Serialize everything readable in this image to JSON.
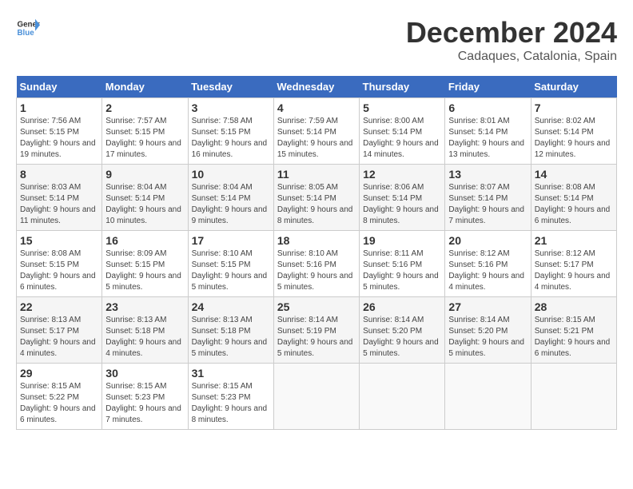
{
  "header": {
    "logo_general": "General",
    "logo_blue": "Blue",
    "month_title": "December 2024",
    "location": "Cadaques, Catalonia, Spain"
  },
  "calendar": {
    "days_of_week": [
      "Sunday",
      "Monday",
      "Tuesday",
      "Wednesday",
      "Thursday",
      "Friday",
      "Saturday"
    ],
    "weeks": [
      [
        {
          "day": "1",
          "sunrise": "Sunrise: 7:56 AM",
          "sunset": "Sunset: 5:15 PM",
          "daylight": "Daylight: 9 hours and 19 minutes."
        },
        {
          "day": "2",
          "sunrise": "Sunrise: 7:57 AM",
          "sunset": "Sunset: 5:15 PM",
          "daylight": "Daylight: 9 hours and 17 minutes."
        },
        {
          "day": "3",
          "sunrise": "Sunrise: 7:58 AM",
          "sunset": "Sunset: 5:15 PM",
          "daylight": "Daylight: 9 hours and 16 minutes."
        },
        {
          "day": "4",
          "sunrise": "Sunrise: 7:59 AM",
          "sunset": "Sunset: 5:14 PM",
          "daylight": "Daylight: 9 hours and 15 minutes."
        },
        {
          "day": "5",
          "sunrise": "Sunrise: 8:00 AM",
          "sunset": "Sunset: 5:14 PM",
          "daylight": "Daylight: 9 hours and 14 minutes."
        },
        {
          "day": "6",
          "sunrise": "Sunrise: 8:01 AM",
          "sunset": "Sunset: 5:14 PM",
          "daylight": "Daylight: 9 hours and 13 minutes."
        },
        {
          "day": "7",
          "sunrise": "Sunrise: 8:02 AM",
          "sunset": "Sunset: 5:14 PM",
          "daylight": "Daylight: 9 hours and 12 minutes."
        }
      ],
      [
        {
          "day": "8",
          "sunrise": "Sunrise: 8:03 AM",
          "sunset": "Sunset: 5:14 PM",
          "daylight": "Daylight: 9 hours and 11 minutes."
        },
        {
          "day": "9",
          "sunrise": "Sunrise: 8:04 AM",
          "sunset": "Sunset: 5:14 PM",
          "daylight": "Daylight: 9 hours and 10 minutes."
        },
        {
          "day": "10",
          "sunrise": "Sunrise: 8:04 AM",
          "sunset": "Sunset: 5:14 PM",
          "daylight": "Daylight: 9 hours and 9 minutes."
        },
        {
          "day": "11",
          "sunrise": "Sunrise: 8:05 AM",
          "sunset": "Sunset: 5:14 PM",
          "daylight": "Daylight: 9 hours and 8 minutes."
        },
        {
          "day": "12",
          "sunrise": "Sunrise: 8:06 AM",
          "sunset": "Sunset: 5:14 PM",
          "daylight": "Daylight: 9 hours and 8 minutes."
        },
        {
          "day": "13",
          "sunrise": "Sunrise: 8:07 AM",
          "sunset": "Sunset: 5:14 PM",
          "daylight": "Daylight: 9 hours and 7 minutes."
        },
        {
          "day": "14",
          "sunrise": "Sunrise: 8:08 AM",
          "sunset": "Sunset: 5:14 PM",
          "daylight": "Daylight: 9 hours and 6 minutes."
        }
      ],
      [
        {
          "day": "15",
          "sunrise": "Sunrise: 8:08 AM",
          "sunset": "Sunset: 5:15 PM",
          "daylight": "Daylight: 9 hours and 6 minutes."
        },
        {
          "day": "16",
          "sunrise": "Sunrise: 8:09 AM",
          "sunset": "Sunset: 5:15 PM",
          "daylight": "Daylight: 9 hours and 5 minutes."
        },
        {
          "day": "17",
          "sunrise": "Sunrise: 8:10 AM",
          "sunset": "Sunset: 5:15 PM",
          "daylight": "Daylight: 9 hours and 5 minutes."
        },
        {
          "day": "18",
          "sunrise": "Sunrise: 8:10 AM",
          "sunset": "Sunset: 5:16 PM",
          "daylight": "Daylight: 9 hours and 5 minutes."
        },
        {
          "day": "19",
          "sunrise": "Sunrise: 8:11 AM",
          "sunset": "Sunset: 5:16 PM",
          "daylight": "Daylight: 9 hours and 5 minutes."
        },
        {
          "day": "20",
          "sunrise": "Sunrise: 8:12 AM",
          "sunset": "Sunset: 5:16 PM",
          "daylight": "Daylight: 9 hours and 4 minutes."
        },
        {
          "day": "21",
          "sunrise": "Sunrise: 8:12 AM",
          "sunset": "Sunset: 5:17 PM",
          "daylight": "Daylight: 9 hours and 4 minutes."
        }
      ],
      [
        {
          "day": "22",
          "sunrise": "Sunrise: 8:13 AM",
          "sunset": "Sunset: 5:17 PM",
          "daylight": "Daylight: 9 hours and 4 minutes."
        },
        {
          "day": "23",
          "sunrise": "Sunrise: 8:13 AM",
          "sunset": "Sunset: 5:18 PM",
          "daylight": "Daylight: 9 hours and 4 minutes."
        },
        {
          "day": "24",
          "sunrise": "Sunrise: 8:13 AM",
          "sunset": "Sunset: 5:18 PM",
          "daylight": "Daylight: 9 hours and 5 minutes."
        },
        {
          "day": "25",
          "sunrise": "Sunrise: 8:14 AM",
          "sunset": "Sunset: 5:19 PM",
          "daylight": "Daylight: 9 hours and 5 minutes."
        },
        {
          "day": "26",
          "sunrise": "Sunrise: 8:14 AM",
          "sunset": "Sunset: 5:20 PM",
          "daylight": "Daylight: 9 hours and 5 minutes."
        },
        {
          "day": "27",
          "sunrise": "Sunrise: 8:14 AM",
          "sunset": "Sunset: 5:20 PM",
          "daylight": "Daylight: 9 hours and 5 minutes."
        },
        {
          "day": "28",
          "sunrise": "Sunrise: 8:15 AM",
          "sunset": "Sunset: 5:21 PM",
          "daylight": "Daylight: 9 hours and 6 minutes."
        }
      ],
      [
        {
          "day": "29",
          "sunrise": "Sunrise: 8:15 AM",
          "sunset": "Sunset: 5:22 PM",
          "daylight": "Daylight: 9 hours and 6 minutes."
        },
        {
          "day": "30",
          "sunrise": "Sunrise: 8:15 AM",
          "sunset": "Sunset: 5:23 PM",
          "daylight": "Daylight: 9 hours and 7 minutes."
        },
        {
          "day": "31",
          "sunrise": "Sunrise: 8:15 AM",
          "sunset": "Sunset: 5:23 PM",
          "daylight": "Daylight: 9 hours and 8 minutes."
        },
        null,
        null,
        null,
        null
      ]
    ]
  }
}
